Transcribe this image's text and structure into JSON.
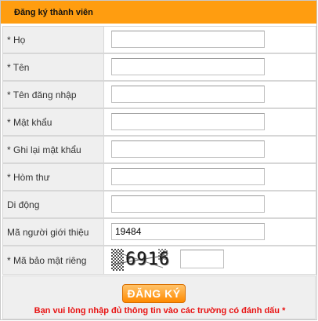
{
  "form": {
    "title": "Đăng ký thành viên",
    "fields": [
      {
        "label": "* Họ",
        "value": ""
      },
      {
        "label": "* Tên",
        "value": ""
      },
      {
        "label": "* Tên đăng nhập",
        "value": ""
      },
      {
        "label": "* Mật khẩu",
        "value": ""
      },
      {
        "label": "* Ghi lại mật khẩu",
        "value": ""
      },
      {
        "label": "* Hòm thư",
        "value": ""
      },
      {
        "label": "Di động",
        "value": ""
      },
      {
        "label": "Mã người giới thiệu",
        "value": "19484"
      }
    ],
    "captcha": {
      "label": "* Mã bảo mật riêng",
      "image_text": "6916",
      "value": ""
    },
    "submit_label": "ĐĂNG KÝ",
    "required_note": "Bạn vui lòng nhập đủ thông tin vào các trường có đánh dấu *"
  },
  "colors": {
    "header": "#ff9d10",
    "label_bg": "#efefef",
    "note": "#e81212"
  }
}
